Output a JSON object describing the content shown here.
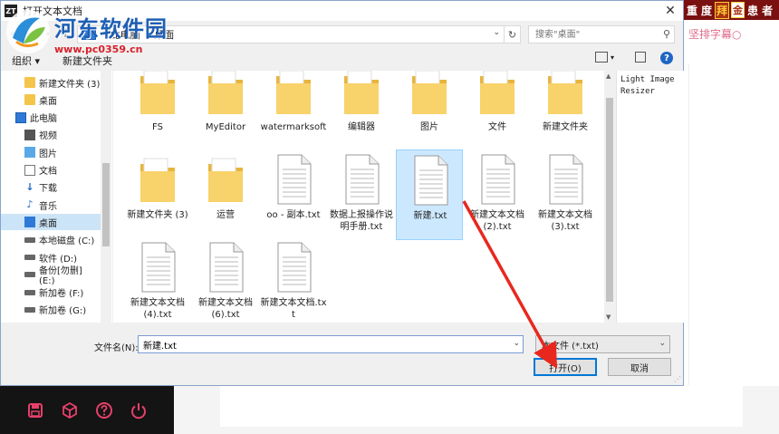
{
  "background_app": {
    "banner_chars": [
      "重",
      "度",
      "拜",
      "金",
      "患",
      "者"
    ],
    "subtitle": "坚排字幕○",
    "preview_text": "Light Image Resizer"
  },
  "dialog": {
    "app_icon_text": "ZT",
    "title": "打开文本文档",
    "close_glyph": "✕",
    "address": {
      "crumbs": [
        "此电脑",
        "桌面"
      ],
      "separator": "›"
    },
    "search_placeholder": "搜索\"桌面\"",
    "toolbar": {
      "organize": "组织 ▾",
      "new_folder": "新建文件夹"
    },
    "nav": {
      "items": [
        {
          "label": "新建文件夹 (3)",
          "icon": "folder-icon",
          "indent": 1
        },
        {
          "label": "桌面",
          "icon": "folder-icon",
          "indent": 1
        },
        {
          "label": "此电脑",
          "icon": "computer-icon",
          "indent": 0
        },
        {
          "label": "视频",
          "icon": "video-icon",
          "indent": 1
        },
        {
          "label": "图片",
          "icon": "picture-icon",
          "indent": 1
        },
        {
          "label": "文档",
          "icon": "document-icon",
          "indent": 1
        },
        {
          "label": "下载",
          "icon": "download-icon",
          "indent": 1
        },
        {
          "label": "音乐",
          "icon": "music-icon",
          "indent": 1
        },
        {
          "label": "桌面",
          "icon": "desktop-icon",
          "indent": 1,
          "selected": true
        },
        {
          "label": "本地磁盘 (C:)",
          "icon": "drive-icon",
          "indent": 1
        },
        {
          "label": "软件 (D:)",
          "icon": "drive-icon",
          "indent": 1
        },
        {
          "label": "备份[勿删] (E:)",
          "icon": "drive-icon",
          "indent": 1
        },
        {
          "label": "新加卷 (F:)",
          "icon": "drive-icon",
          "indent": 1
        },
        {
          "label": "新加卷 (G:)",
          "icon": "drive-icon",
          "indent": 1
        }
      ]
    },
    "files": [
      {
        "label": "FS",
        "type": "folder"
      },
      {
        "label": "MyEditor",
        "type": "folder"
      },
      {
        "label": "watermarksoft",
        "type": "folder"
      },
      {
        "label": "编辑器",
        "type": "folder"
      },
      {
        "label": "图片",
        "type": "folder"
      },
      {
        "label": "文件",
        "type": "folder"
      },
      {
        "label": "新建文件夹",
        "type": "folder"
      },
      {
        "label": "新建文件夹 (3)",
        "type": "folder"
      },
      {
        "label": "运营",
        "type": "folder"
      },
      {
        "label": "oo - 副本.txt",
        "type": "txt"
      },
      {
        "label": "数据上报操作说明手册.txt",
        "type": "txt"
      },
      {
        "label": "新建.txt",
        "type": "txt",
        "selected": true
      },
      {
        "label": "新建文本文档 (2).txt",
        "type": "txt"
      },
      {
        "label": "新建文本文档 (3).txt",
        "type": "txt"
      },
      {
        "label": "新建文本文档 (4).txt",
        "type": "txt"
      },
      {
        "label": "新建文本文档 (6).txt",
        "type": "txt"
      },
      {
        "label": "新建文本文档.txt",
        "type": "txt"
      }
    ],
    "filename_label": "文件名(N):",
    "filename_value": "新建.txt",
    "filetype_value": "本文件 (*.txt)",
    "open_button": "打开(O)",
    "cancel_button": "取消"
  },
  "watermark": {
    "title": "河东软件园",
    "url": "www.pc0359.cn"
  },
  "colors": {
    "accent": "#0078d7",
    "selection": "#cce8ff",
    "annotation_arrow": "#e8281e",
    "watermark_blue": "#1e5fb4",
    "watermark_red": "#d9202a"
  }
}
